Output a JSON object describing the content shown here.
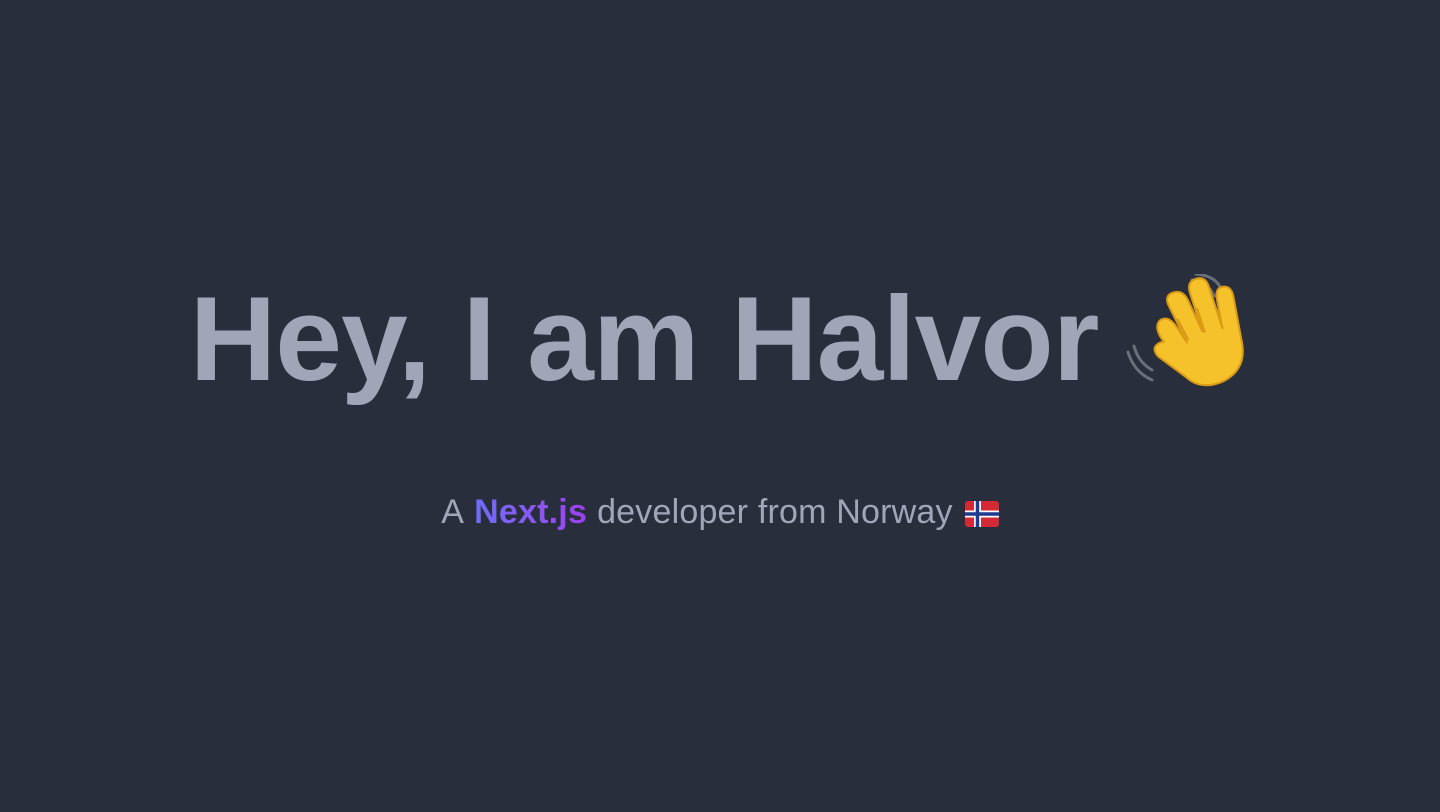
{
  "theme": {
    "background": "#292e3c",
    "text_color": "#a0a6b8",
    "brand_gradient": [
      "#6f6cf8",
      "#9b3ff0"
    ]
  },
  "hero": {
    "title": "Hey, I am Halvor",
    "title_icon": "waving-hand-icon"
  },
  "subtitle": {
    "prefix": "A",
    "highlight": "Next.js",
    "suffix": "developer from Norway",
    "flag_icon": "norway-flag-icon"
  }
}
